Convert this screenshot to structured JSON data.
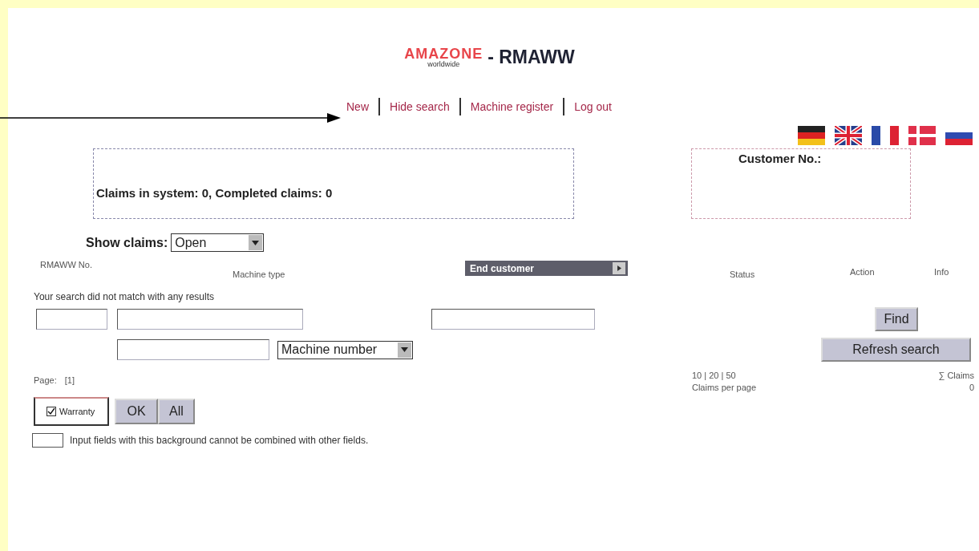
{
  "header": {
    "logo": "AMAZONE",
    "logo_sub": "worldwide",
    "title": "- RMAWW"
  },
  "nav": [
    {
      "label": "New"
    },
    {
      "label": "Hide search"
    },
    {
      "label": "Machine register"
    },
    {
      "label": "Log out"
    }
  ],
  "languages": [
    {
      "kind": "de"
    },
    {
      "kind": "uk"
    },
    {
      "kind": "fr"
    },
    {
      "kind": "dk"
    },
    {
      "kind": "ru"
    }
  ],
  "summary": "Claims in system: 0, Completed claims: 0",
  "customer": {
    "label": "Customer No.:"
  },
  "show_claims": {
    "label": "Show claims:",
    "value": "Open"
  },
  "columns": [
    {
      "kind": "text",
      "label": "RMAWW No."
    },
    {
      "kind": "text",
      "label": "Machine type"
    },
    {
      "kind": "select",
      "label": "End customer"
    },
    {
      "kind": "text",
      "label": "Status"
    },
    {
      "kind": "text",
      "label": "Action"
    },
    {
      "kind": "text",
      "label": "Info"
    }
  ],
  "message": "Your search did not match with any results",
  "machine_select": {
    "value": "Machine number"
  },
  "buttons": {
    "find": "Find",
    "refresh": "Refresh search"
  },
  "pagination": {
    "label": "Page:",
    "pages": "[1]",
    "sizes": "10 | 20 | 50",
    "sizes_label": "Claims per page",
    "total_label": "∑ Claims",
    "total": "0"
  },
  "warranty": {
    "label": "Warranty",
    "checked": true
  },
  "actions": {
    "ok": "OK",
    "all": "All"
  },
  "legend": "Input fields with this background cannot be combined with other fields."
}
